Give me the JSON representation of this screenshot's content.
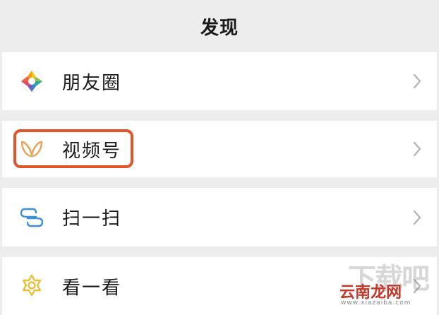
{
  "header": {
    "title": "发现"
  },
  "items": [
    {
      "label": "朋友圈",
      "icon": "moments-aperture-icon"
    },
    {
      "label": "视频号",
      "icon": "channels-butterfly-icon"
    },
    {
      "label": "扫一扫",
      "icon": "scan-icon"
    },
    {
      "label": "看一看",
      "icon": "top-stories-icon"
    }
  ],
  "highlight_color": "#e0542b",
  "watermark": {
    "big": "下载吧",
    "brand": "云南龙网",
    "url": "www.xiazaiba.com"
  }
}
